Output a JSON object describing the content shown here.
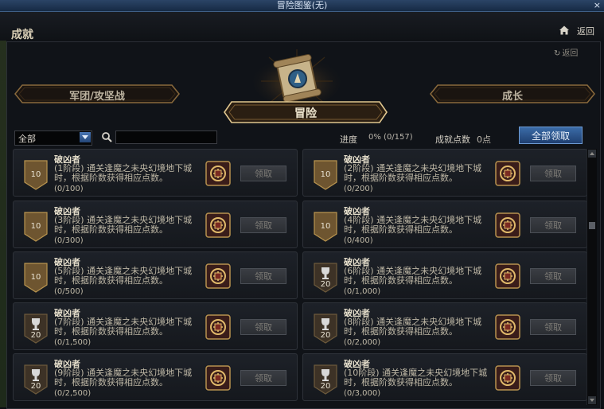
{
  "window": {
    "title": "冒险图鉴(无)",
    "close_glyph": "×"
  },
  "header": {
    "title": "成就",
    "back_label": "返回",
    "home_icon": "home-icon"
  },
  "panel": {
    "back_label": "返回"
  },
  "tabs": {
    "left": "军团/攻坚战",
    "center": "冒险",
    "right": "成长"
  },
  "toolbar": {
    "filter_value": "全部",
    "search_placeholder": "",
    "progress_label": "进度",
    "progress_value": "0%  (0/157)",
    "points_label": "成就点数",
    "points_value": "0点",
    "claim_all_label": "全部领取"
  },
  "colors": {
    "accent_blue": "#3b6ca8",
    "gold": "#c4a15a",
    "card_bg": "#1d2128"
  },
  "achievements": [
    {
      "title": "破凶者",
      "desc": "(1阶段) 通关逢魔之未央幻境地下城时，根据阶数获得相应点数。",
      "count": "(0/100)",
      "badge_type": "shield",
      "points": "10",
      "claim_label": "领取"
    },
    {
      "title": "破凶者",
      "desc": "(2阶段) 通关逢魔之未央幻境地下城时，根据阶数获得相应点数。",
      "count": "(0/200)",
      "badge_type": "shield",
      "points": "10",
      "claim_label": "领取"
    },
    {
      "title": "破凶者",
      "desc": "(3阶段) 通关逢魔之未央幻境地下城时，根据阶数获得相应点数。",
      "count": "(0/300)",
      "badge_type": "shield",
      "points": "10",
      "claim_label": "领取"
    },
    {
      "title": "破凶者",
      "desc": "(4阶段) 通关逢魔之未央幻境地下城时，根据阶数获得相应点数。",
      "count": "(0/400)",
      "badge_type": "shield",
      "points": "10",
      "claim_label": "领取"
    },
    {
      "title": "破凶者",
      "desc": "(5阶段) 通关逢魔之未央幻境地下城时，根据阶数获得相应点数。",
      "count": "(0/500)",
      "badge_type": "shield",
      "points": "10",
      "claim_label": "领取"
    },
    {
      "title": "破凶者",
      "desc": "(6阶段) 通关逢魔之未央幻境地下城时，根据阶数获得相应点数。",
      "count": "(0/1,000)",
      "badge_type": "trophy",
      "points": "20",
      "claim_label": "领取"
    },
    {
      "title": "破凶者",
      "desc": "(7阶段) 通关逢魔之未央幻境地下城时，根据阶数获得相应点数。",
      "count": "(0/1,500)",
      "badge_type": "trophy",
      "points": "20",
      "claim_label": "领取"
    },
    {
      "title": "破凶者",
      "desc": "(8阶段) 通关逢魔之未央幻境地下城时，根据阶数获得相应点数。",
      "count": "(0/2,000)",
      "badge_type": "trophy",
      "points": "20",
      "claim_label": "领取"
    },
    {
      "title": "破凶者",
      "desc": "(9阶段) 通关逢魔之未央幻境地下城时，根据阶数获得相应点数。",
      "count": "(0/2,500)",
      "badge_type": "trophy",
      "points": "20",
      "claim_label": "领取"
    },
    {
      "title": "破凶者",
      "desc": "(10阶段) 通关逢魔之未央幻境地下城时，根据阶数获得相应点数。",
      "count": "(0/3,000)",
      "badge_type": "trophy",
      "points": "20",
      "claim_label": "领取"
    }
  ]
}
